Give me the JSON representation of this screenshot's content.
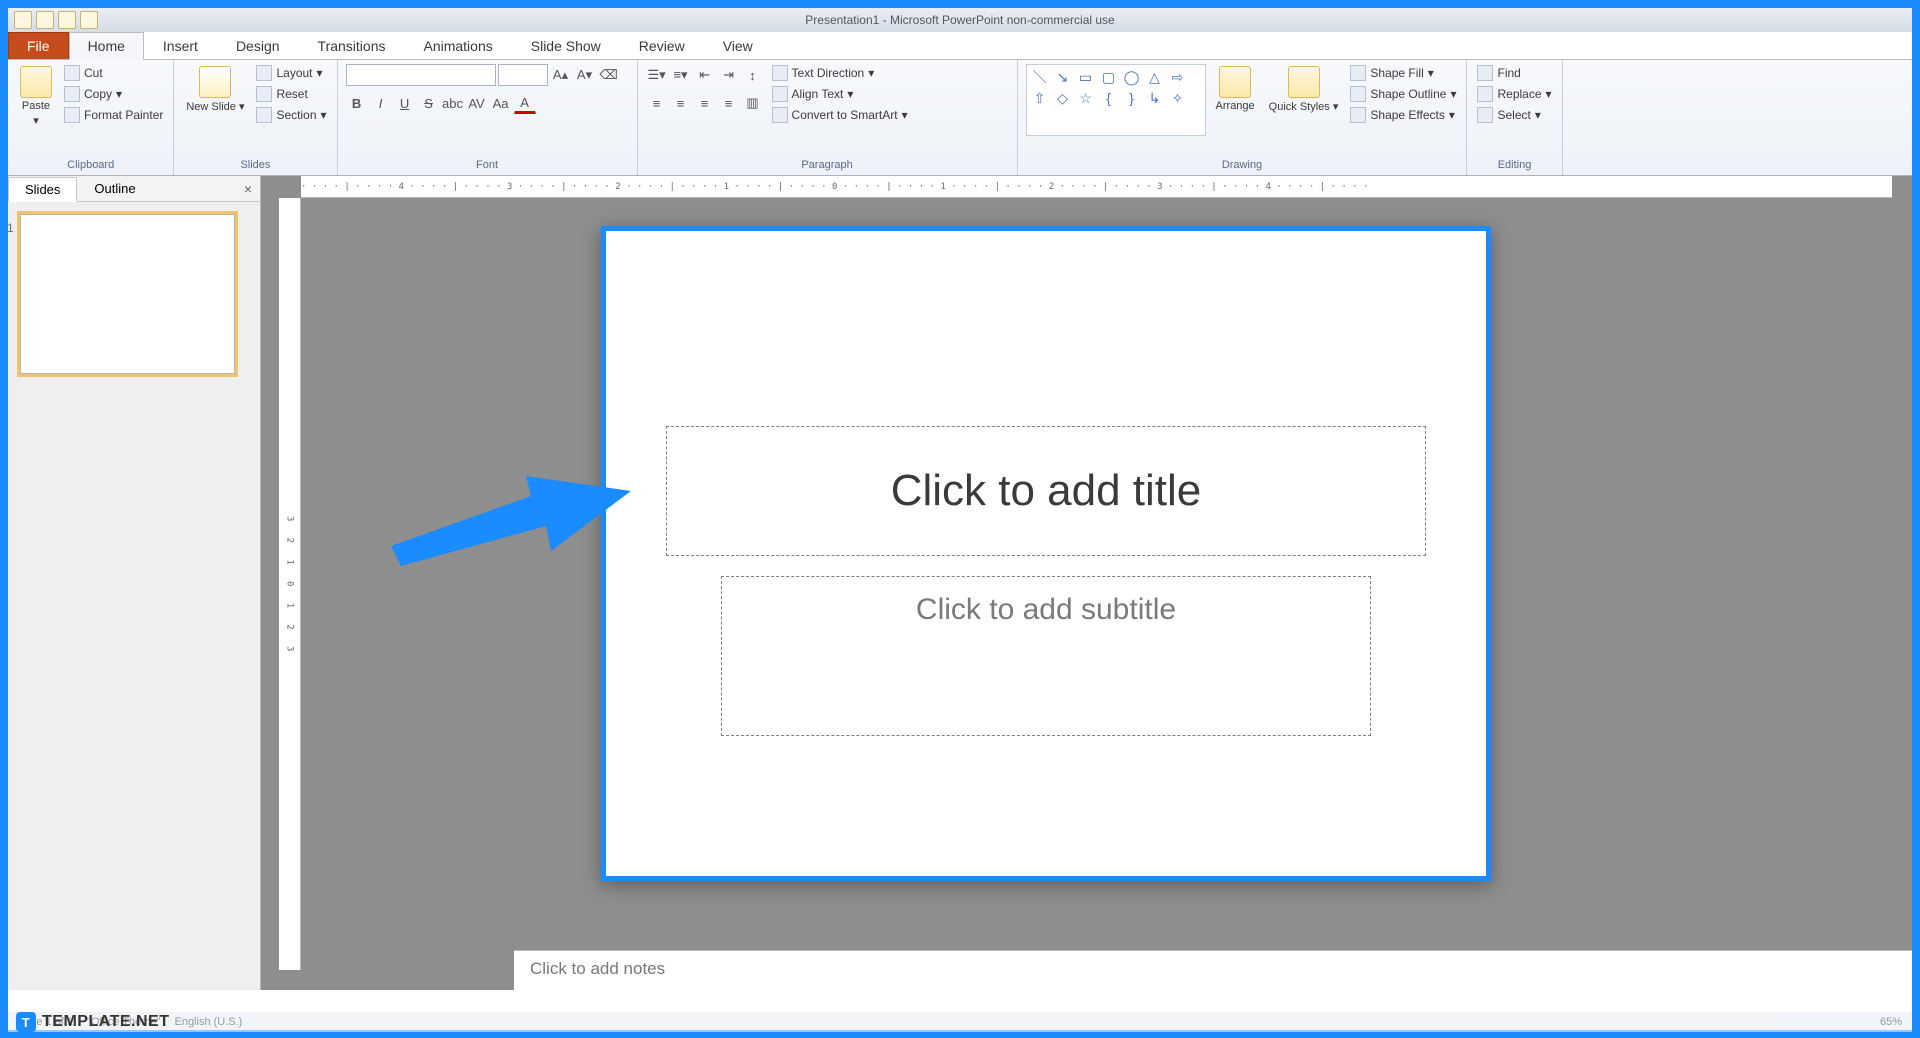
{
  "title_bar": "Presentation1 - Microsoft PowerPoint non-commercial use",
  "tabs": {
    "file": "File",
    "home": "Home",
    "insert": "Insert",
    "design": "Design",
    "transitions": "Transitions",
    "animations": "Animations",
    "slideshow": "Slide Show",
    "review": "Review",
    "view": "View"
  },
  "ribbon": {
    "clipboard": {
      "label": "Clipboard",
      "paste": "Paste",
      "cut": "Cut",
      "copy": "Copy",
      "format_painter": "Format Painter"
    },
    "slides": {
      "label": "Slides",
      "new_slide": "New Slide",
      "layout": "Layout",
      "reset": "Reset",
      "section": "Section"
    },
    "font": {
      "label": "Font",
      "name": "",
      "size": "",
      "bold": "B",
      "italic": "I",
      "underline": "U",
      "strike": "S",
      "shadow": "abc",
      "spacing": "AV",
      "case": "Aa",
      "color": "A"
    },
    "paragraph": {
      "label": "Paragraph",
      "text_direction": "Text Direction",
      "align_text": "Align Text",
      "convert_smartart": "Convert to SmartArt"
    },
    "drawing": {
      "label": "Drawing",
      "arrange": "Arrange",
      "quick_styles": "Quick Styles",
      "shape_fill": "Shape Fill",
      "shape_outline": "Shape Outline",
      "shape_effects": "Shape Effects"
    },
    "editing": {
      "label": "Editing",
      "find": "Find",
      "replace": "Replace",
      "select": "Select"
    }
  },
  "side_tabs": {
    "slides": "Slides",
    "outline": "Outline"
  },
  "thumb_number": "1",
  "slide": {
    "title_placeholder": "Click to add title",
    "subtitle_placeholder": "Click to add subtitle"
  },
  "notes_placeholder": "Click to add notes",
  "ruler_h": "· · · · | · · · · 4 · · · · | · · · · 3 · · · · | · · · · 2 · · · · | · · · · 1 · · · · | · · · · 0 · · · · | · · · · 1 · · · · | · · · · 2 · · · · | · · · · 3 · · · · | · · · · 4 · · · · | · · · ·",
  "ruler_v": "3   2   1   0   1   2   3",
  "status": {
    "slide_of": "Slide 1 of 1",
    "theme": "\"Office Theme\"",
    "lang": "English (U.S.)",
    "zoom": "65%"
  },
  "branding": "TEMPLATE.NET"
}
